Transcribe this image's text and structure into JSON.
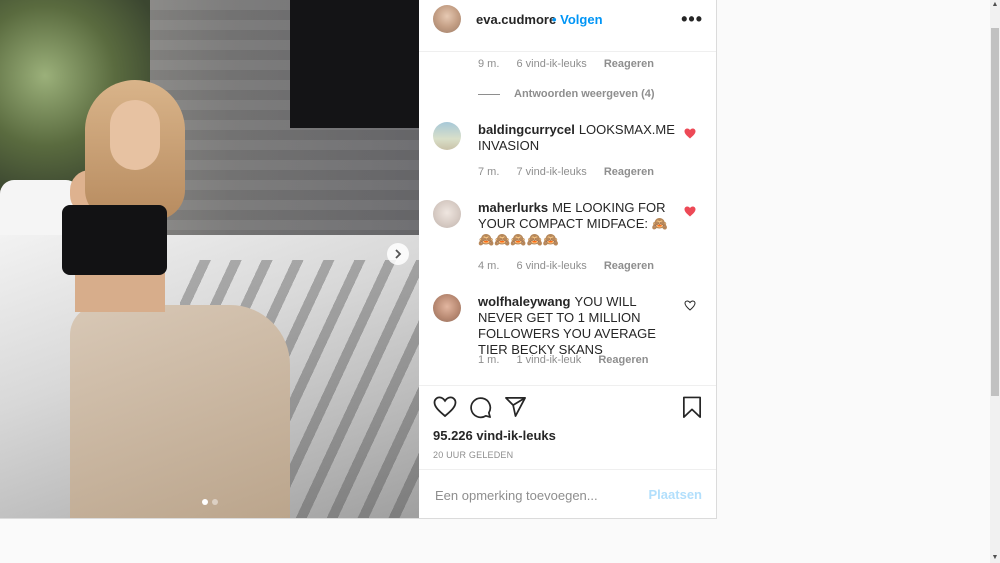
{
  "header": {
    "username": "eva.cudmore",
    "follow_label": "• Volgen",
    "more_label": "•••"
  },
  "prior_comment_meta": {
    "time": "9 m.",
    "likes": "6 vind-ik-leuks",
    "reply": "Reageren"
  },
  "view_replies": "Antwoorden weergeven (4)",
  "comments": [
    {
      "username": "baldingcurrycel",
      "text": "LOOKSMAX.ME INVASION",
      "time": "7 m.",
      "likes": "7 vind-ik-leuks",
      "reply": "Reageren",
      "liked": true
    },
    {
      "username": "maherlurks",
      "text": "ME LOOKING FOR YOUR COMPACT MIDFACE: 🙈 🙈🙈🙈🙈🙈",
      "time": "4 m.",
      "likes": "6 vind-ik-leuks",
      "reply": "Reageren",
      "liked": true
    },
    {
      "username": "wolfhaleywang",
      "text": "YOU WILL NEVER GET TO 1 MILLION FOLLOWERS YOU AVERAGE TIER BECKY SKANS",
      "time": "1 m.",
      "likes": "1 vind-ik-leuk",
      "reply": "Reageren",
      "liked": false
    }
  ],
  "actions": {
    "likes": "95.226 vind-ik-leuks",
    "time_ago": "20 UUR GELEDEN"
  },
  "add_comment": {
    "placeholder": "Een opmerking toevoegen...",
    "post_label": "Plaatsen"
  },
  "carousel": {
    "total": 2,
    "active_index": 0
  },
  "colors": {
    "accent": "#0095f6",
    "liked_heart": "#ed4956",
    "post_disabled": "#b2dffc"
  }
}
